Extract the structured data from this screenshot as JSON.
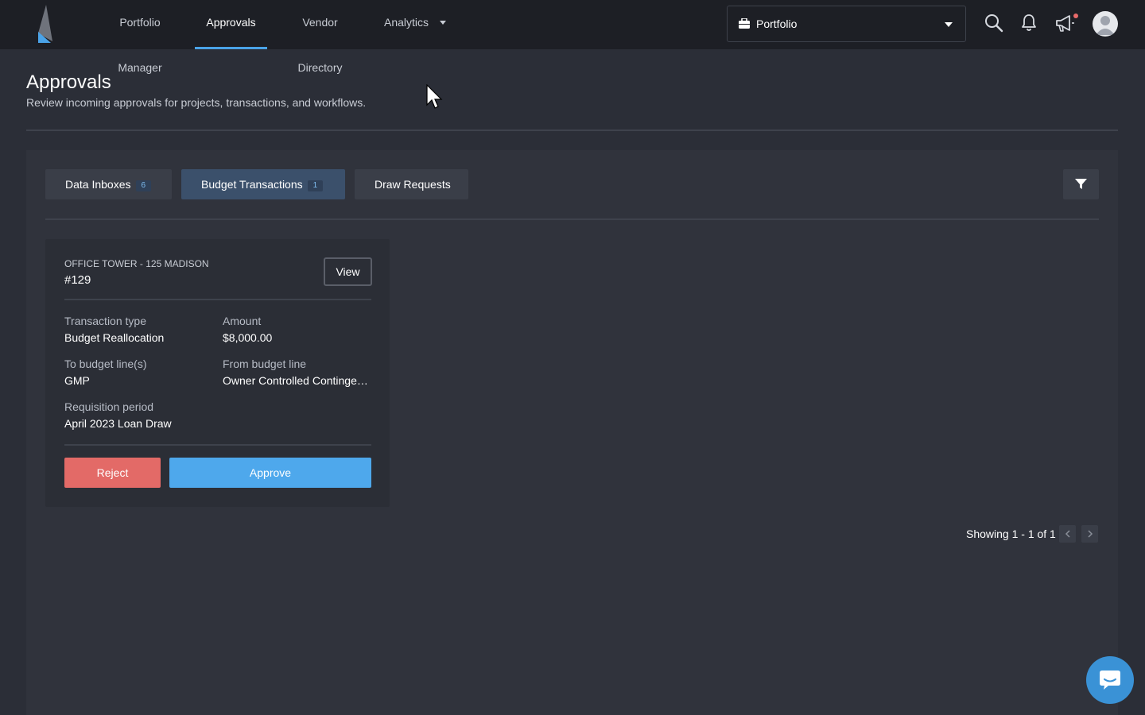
{
  "nav": {
    "items": [
      {
        "label": "Portfolio Manager"
      },
      {
        "label": "Approvals",
        "active": true
      },
      {
        "label": "Vendor Directory"
      },
      {
        "label": "Analytics",
        "has_dropdown": true
      }
    ],
    "portfolio_select": {
      "value": "Portfolio",
      "icon": "briefcase-icon"
    },
    "icons": [
      "search-icon",
      "bell-icon",
      "megaphone-icon",
      "avatar"
    ]
  },
  "page": {
    "title": "Approvals",
    "subtitle": "Review incoming approvals for projects, transactions, and workflows."
  },
  "tabs": [
    {
      "label": "Data Inboxes",
      "count": "6"
    },
    {
      "label": "Budget Transactions",
      "count": "1",
      "active": true
    },
    {
      "label": "Draw Requests"
    }
  ],
  "card": {
    "project": "OFFICE TOWER - 125 MADISON",
    "number": "#129",
    "view_label": "View",
    "fields": {
      "transaction_type": {
        "label": "Transaction type",
        "value": "Budget Reallocation"
      },
      "amount": {
        "label": "Amount",
        "value": "$8,000.00"
      },
      "to_budget": {
        "label": "To budget line(s)",
        "value": "GMP"
      },
      "from_budget": {
        "label": "From budget line",
        "value": "Owner Controlled Contingen…"
      },
      "requisition": {
        "label": "Requisition period",
        "value": "April 2023 Loan Draw"
      }
    },
    "reject_label": "Reject",
    "approve_label": "Approve"
  },
  "pagination": {
    "text": "Showing 1 - 1 of 1"
  },
  "colors": {
    "accent": "#4aa3e8",
    "approve": "#4ea8ec",
    "reject": "#e36a67",
    "background": "#2b2e37",
    "topbar": "#1d1f25"
  }
}
